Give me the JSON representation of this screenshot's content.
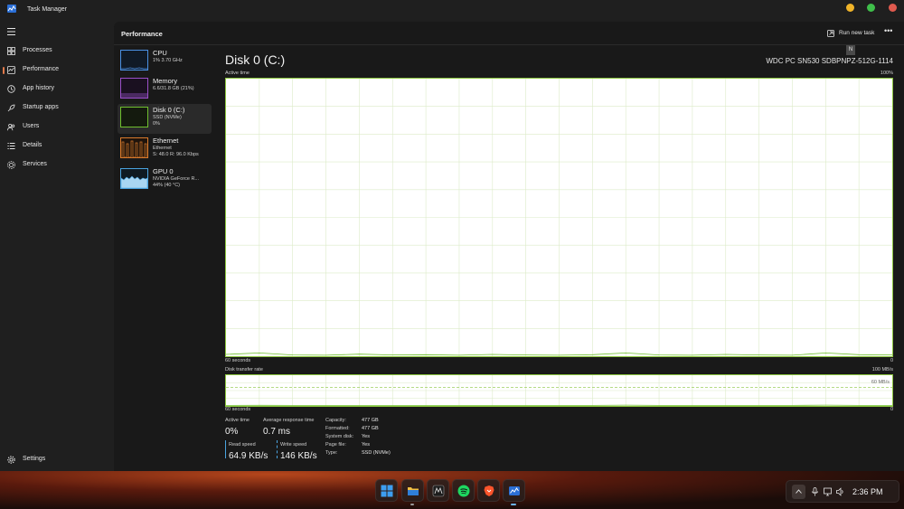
{
  "window": {
    "title": "Task Manager"
  },
  "sidebar": {
    "items": [
      {
        "label": "Processes",
        "icon": "processes-icon",
        "active": false
      },
      {
        "label": "Performance",
        "icon": "performance-icon",
        "active": true
      },
      {
        "label": "App history",
        "icon": "app-history-icon",
        "active": false
      },
      {
        "label": "Startup apps",
        "icon": "startup-apps-icon",
        "active": false
      },
      {
        "label": "Users",
        "icon": "users-icon",
        "active": false
      },
      {
        "label": "Details",
        "icon": "details-icon",
        "active": false
      },
      {
        "label": "Services",
        "icon": "services-icon",
        "active": false
      }
    ],
    "settings_label": "Settings"
  },
  "header": {
    "title": "Performance",
    "run_task_label": "Run new task",
    "more_label": "•••",
    "tooltip": "N"
  },
  "perf_list": [
    {
      "name": "CPU",
      "sub1": "1%  3.70 GHz",
      "sub2": "",
      "color": "#4a90e2"
    },
    {
      "name": "Memory",
      "sub1": "6.6/31.8 GB (21%)",
      "sub2": "",
      "color": "#9b4fc9"
    },
    {
      "name": "Disk 0 (C:)",
      "sub1": "SSD (NVMe)",
      "sub2": "0%",
      "color": "#6fbf2e"
    },
    {
      "name": "Ethernet",
      "sub1": "Ethernet",
      "sub2": "S: 48.0  R: 96.0 Kbps",
      "color": "#d97a2b"
    },
    {
      "name": "GPU 0",
      "sub1": "NVIDIA GeForce R...",
      "sub2": "44% (40 °C)",
      "color": "#4aa3df"
    }
  ],
  "disk": {
    "title": "Disk 0 (C:)",
    "model": "WDC PC SN530 SDBPNPZ-512G-1114",
    "active_time_chart": {
      "label": "Active time",
      "max_label": "100%",
      "time_label": "60 seconds",
      "min_label": "0"
    },
    "transfer_chart": {
      "label": "Disk transfer rate",
      "max_label": "100 MB/s",
      "mid_label": "60 MB/s",
      "time_label": "60 seconds",
      "min_label": "0"
    },
    "stats": {
      "active_time_label": "Active time",
      "active_time_value": "0%",
      "response_label": "Average response time",
      "response_value": "0.7 ms",
      "read_label": "Read speed",
      "read_value": "64.9 KB/s",
      "write_label": "Write speed",
      "write_value": "146 KB/s"
    },
    "properties": [
      {
        "key": "Capacity:",
        "value": "477 GB"
      },
      {
        "key": "Formatted:",
        "value": "477 GB"
      },
      {
        "key": "System disk:",
        "value": "Yes"
      },
      {
        "key": "Page file:",
        "value": "Yes"
      },
      {
        "key": "Type:",
        "value": "SSD (NVMe)"
      }
    ]
  },
  "chart_data": [
    {
      "type": "line",
      "title": "Active time",
      "xlabel": "60 seconds",
      "ylim": [
        0,
        100
      ],
      "unit": "%",
      "x": [
        0,
        3,
        6,
        9,
        12,
        15,
        18,
        21,
        24,
        27,
        30,
        33,
        36,
        39,
        42,
        45,
        48,
        51,
        54,
        57,
        60
      ],
      "series": [
        {
          "values": [
            0.5,
            1,
            0.3,
            0.2,
            0.6,
            0.3,
            0.4,
            0.2,
            0.5,
            0.3,
            0.2,
            0.4,
            1,
            0.3,
            0.2,
            0.5,
            0.3,
            0.2,
            1,
            0.4,
            0.3
          ]
        }
      ]
    },
    {
      "type": "line",
      "title": "Disk transfer rate",
      "xlabel": "60 seconds",
      "ylim": [
        0,
        100
      ],
      "unit": "MB/s",
      "x": [
        0,
        3,
        6,
        9,
        12,
        15,
        18,
        21,
        24,
        27,
        30,
        33,
        36,
        39,
        42,
        45,
        48,
        51,
        54,
        57,
        60
      ],
      "series": [
        {
          "values": [
            0.3,
            0.6,
            0.2,
            0.2,
            0.4,
            0.2,
            0.3,
            0.2,
            0.3,
            0.2,
            0.2,
            0.3,
            1.2,
            0.3,
            0.2,
            0.3,
            0.2,
            0.2,
            1.1,
            0.3,
            0.2
          ]
        }
      ]
    }
  ],
  "taskbar": {
    "apps": [
      "windows-start-icon",
      "file-explorer-icon",
      "game-app-icon",
      "spotify-icon",
      "brave-browser-icon",
      "task-manager-icon"
    ],
    "clock": "2:36 PM"
  },
  "colors": {
    "accent": "#e17a4a",
    "disk_green": "#8cc63f",
    "close": "#e05a4e",
    "minimize": "#f0b429",
    "maximize": "#3fbf4a"
  }
}
